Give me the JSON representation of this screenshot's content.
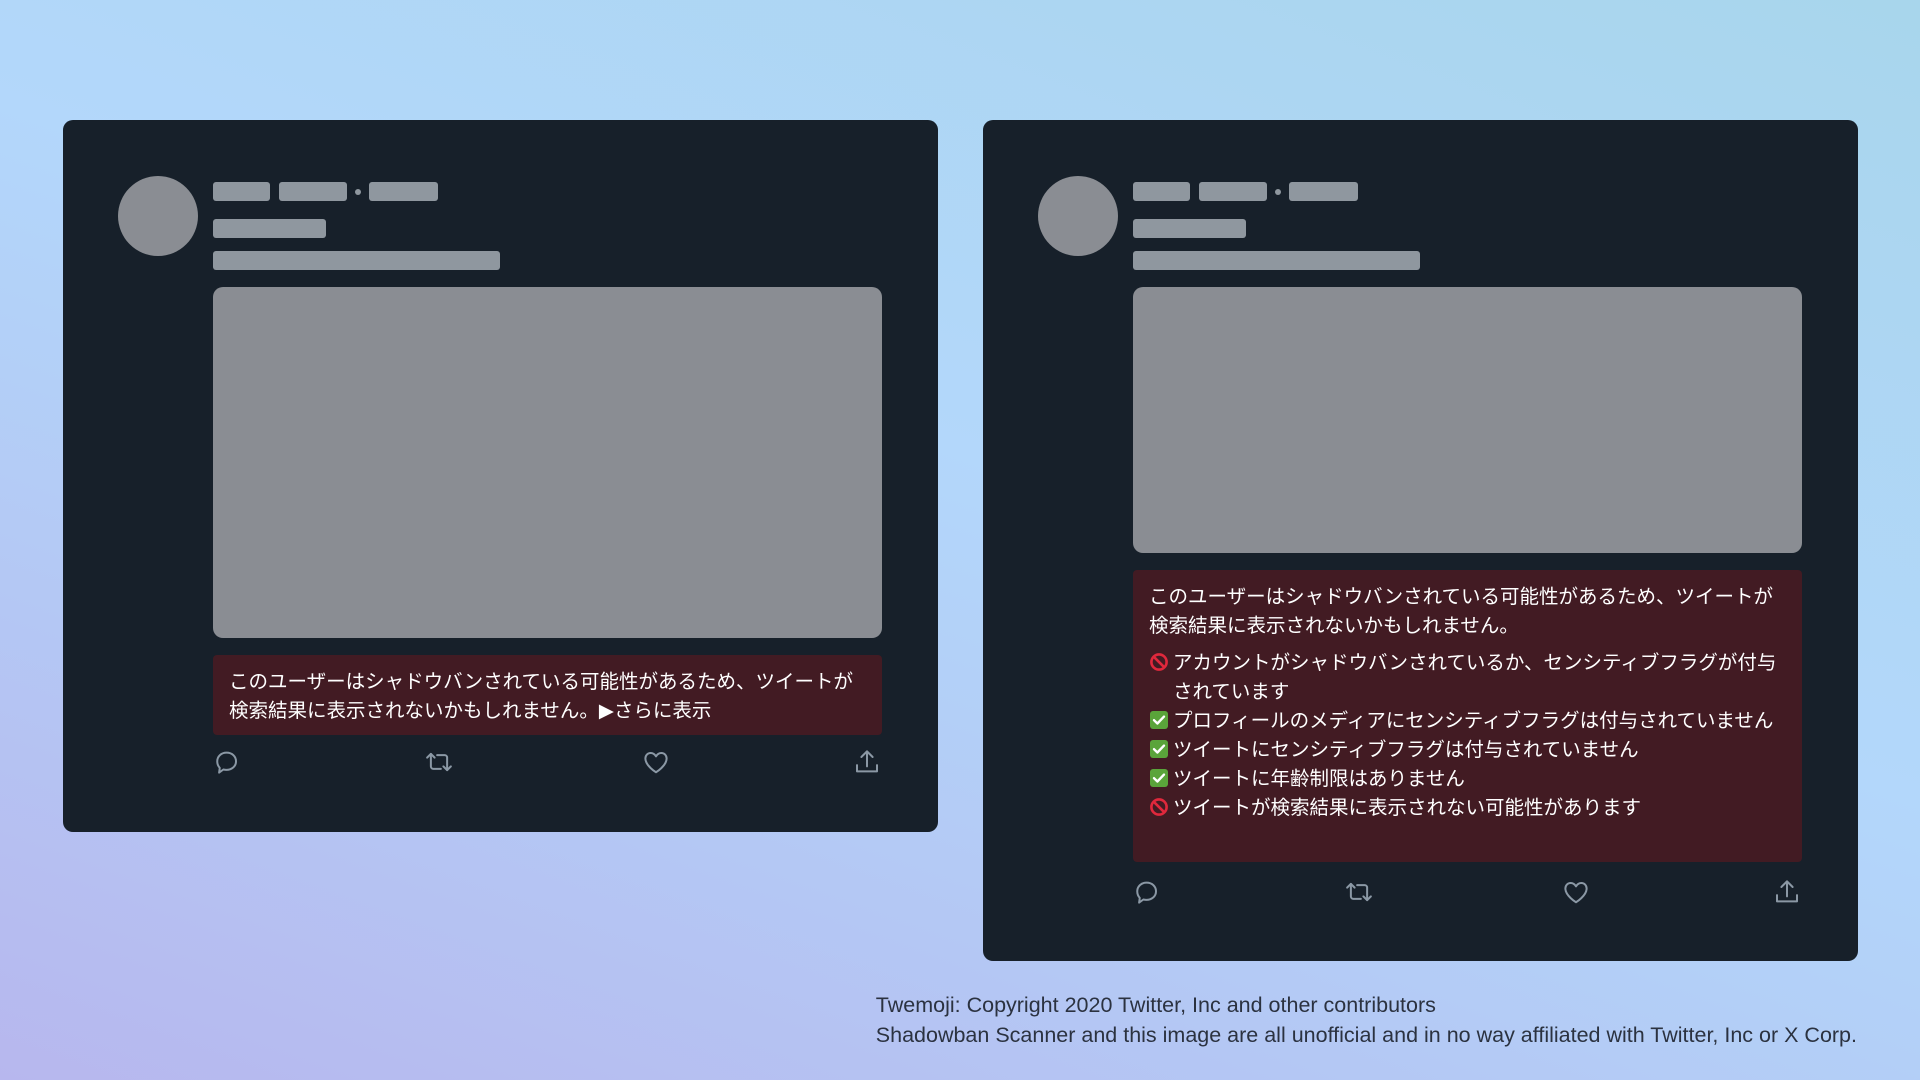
{
  "colors": {
    "card_bg": "#17202a",
    "placeholder": "#8f979f",
    "media": "#8a8d93",
    "warning_bg": "#421b23",
    "warning_text": "#ffffff",
    "prohibited": "#e0283c",
    "check": "#5aa43a"
  },
  "left_card": {
    "warning_text": "このユーザーはシャドウバンされている可能性があるため、ツイートが検索結果に表示されないかもしれません。",
    "show_more": "▶さらに表示"
  },
  "right_card": {
    "warning_text": "このユーザーはシャドウバンされている可能性があるため、ツイートが検索結果に表示されないかもしれません。",
    "checks": [
      {
        "status": "prohibited",
        "icon": "prohibited-icon",
        "text": "アカウントがシャドウバンされているか、センシティブフラグが付与されています"
      },
      {
        "status": "ok",
        "icon": "check-mark-icon",
        "text": "プロフィールのメディアにセンシティブフラグは付与されていません"
      },
      {
        "status": "ok",
        "icon": "check-mark-icon",
        "text": "ツイートにセンシティブフラグは付与されていません"
      },
      {
        "status": "ok",
        "icon": "check-mark-icon",
        "text": "ツイートに年齢制限はありません"
      },
      {
        "status": "prohibited",
        "icon": "prohibited-icon",
        "text": "ツイートが検索結果に表示されない可能性があります"
      }
    ]
  },
  "action_icons": [
    "reply-icon",
    "retweet-icon",
    "like-icon",
    "share-icon"
  ],
  "footer": {
    "line1": "Twemoji: Copyright 2020 Twitter, Inc and other contributors",
    "line2": "Shadowban Scanner and this image are all unofficial and in no way affiliated with Twitter, Inc or X Corp."
  }
}
